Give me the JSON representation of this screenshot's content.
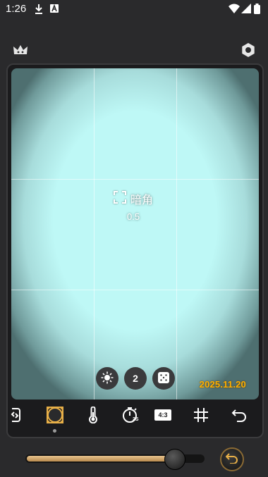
{
  "status_bar": {
    "time": "1:26",
    "icons": [
      "download-icon",
      "font-a-icon",
      "wifi-icon",
      "cell-signal-icon",
      "battery-icon"
    ]
  },
  "top_bar": {
    "left_icon": "crown-icon",
    "right_icon": "settings-icon"
  },
  "viewfinder": {
    "effect_name": "暗角",
    "effect_value": "0.5",
    "exposure_icon": "brightness-icon",
    "count_label": "2",
    "dice_icon": "dice-icon",
    "date_stamp": "2025.11.20"
  },
  "toolbar": {
    "tools": [
      "flip-camera-icon",
      "vignette-icon",
      "temperature-icon",
      "timer-icon",
      "aspect-ratio-icon",
      "grid-icon",
      "undo-icon"
    ],
    "timer_sub": "2S",
    "aspect_label": "4:3",
    "active_tool": "vignette-icon"
  },
  "slider": {
    "value": 0.83
  },
  "colors": {
    "accent": "#e8b048",
    "date": "#ffb000",
    "viewfinder_tint": "#bef8f6",
    "background": "#2a2a2c"
  }
}
